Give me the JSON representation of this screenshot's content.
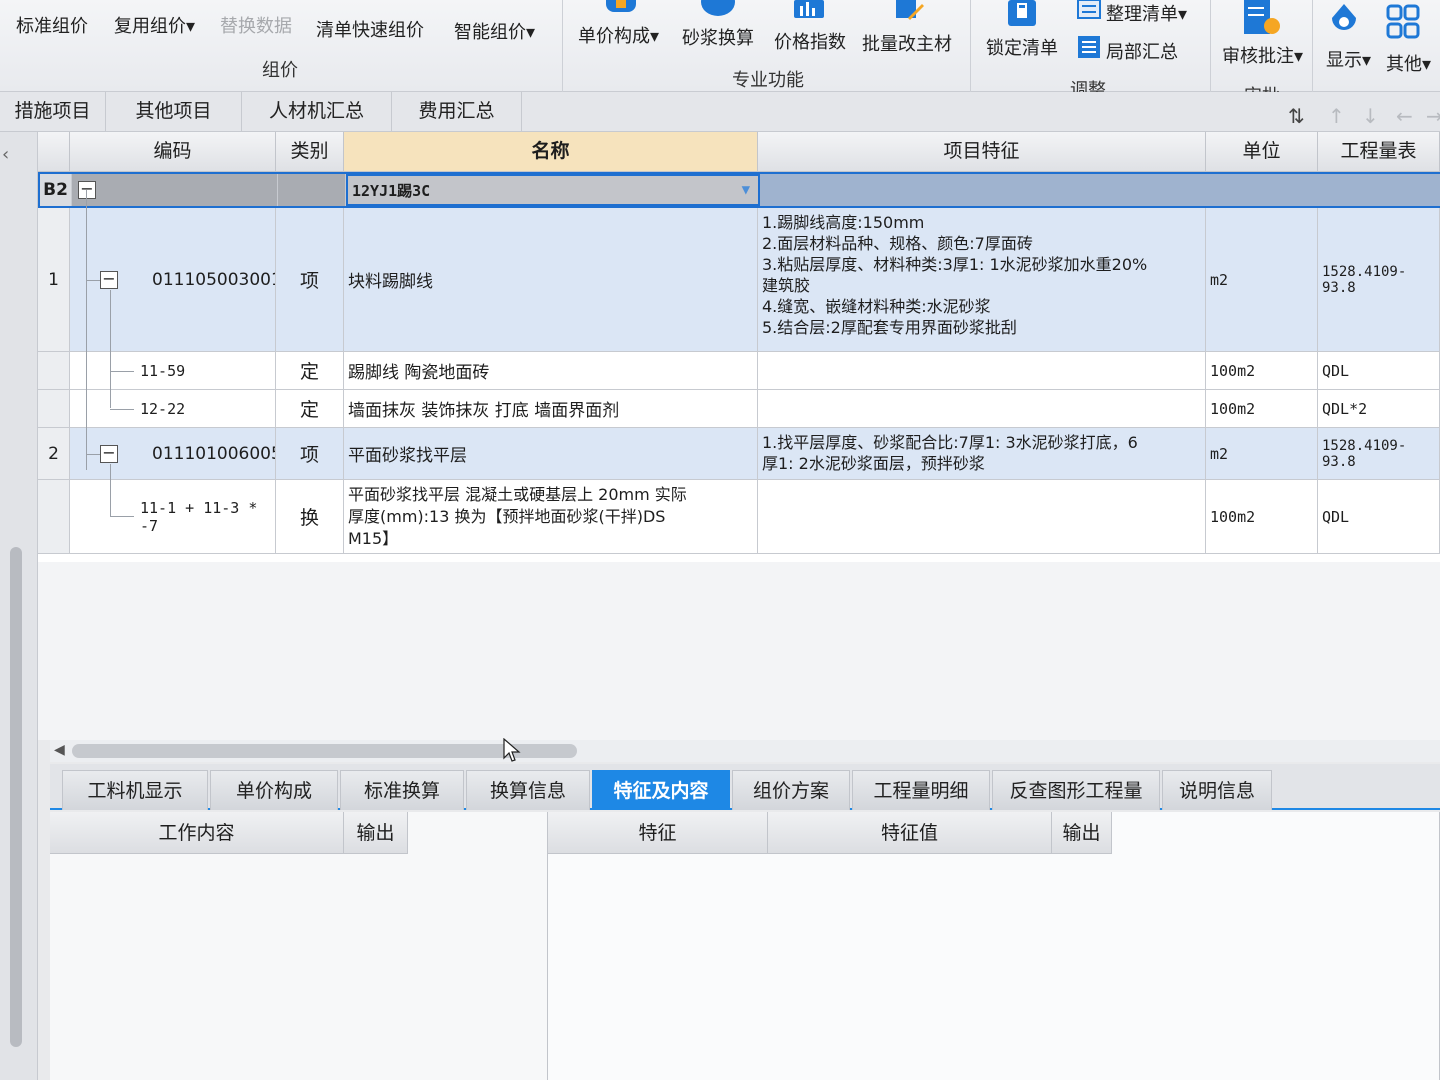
{
  "ribbon": {
    "items": [
      {
        "label": "标准组价"
      },
      {
        "label": "复用组价▾"
      },
      {
        "label": "替换数据",
        "disabled": true
      },
      {
        "label": "清单快速组价"
      },
      {
        "label": "智能组价▾"
      },
      {
        "label": "单价构成▾"
      },
      {
        "label": "砂浆换算"
      },
      {
        "label": "价格指数"
      },
      {
        "label": "批量改主材"
      },
      {
        "label": "锁定清单"
      },
      {
        "label": "整理清单▾"
      },
      {
        "label": "局部汇总"
      },
      {
        "label": "审核批注▾"
      },
      {
        "label": "显示▾"
      },
      {
        "label": "其他▾"
      }
    ],
    "groups": [
      "组价",
      "专业功能",
      "调整",
      "审批"
    ]
  },
  "top_tabs": [
    "措施项目",
    "其他项目",
    "人材机汇总",
    "费用汇总"
  ],
  "grid": {
    "headers": [
      "编码",
      "类别",
      "名称",
      "项目特征",
      "单位",
      "工程量表"
    ],
    "group_row": {
      "num": "B2",
      "name": "12YJ1踢3C"
    },
    "rows": [
      {
        "num": "1",
        "code": "011105003001",
        "type": "项",
        "name": "块料踢脚线",
        "features": [
          "1.踢脚线高度:150mm",
          "2.面层材料品种、规格、颜色:7厚面砖",
          "3.粘贴层厚度、材料种类:3厚1: 1水泥砂浆加水重20%",
          "建筑胶",
          "4.缝宽、嵌缝材料种类:水泥砂浆",
          "5.结合层:2厚配套专用界面砂浆批刮"
        ],
        "unit": "m2",
        "qty": "1528.4109-93.8"
      },
      {
        "num": "",
        "code": "11-59",
        "type": "定",
        "name": "踢脚线 陶瓷地面砖",
        "features": [],
        "unit": "100m2",
        "qty": "QDL"
      },
      {
        "num": "",
        "code": "12-22",
        "type": "定",
        "name": "墙面抹灰 装饰抹灰 打底 墙面界面剂",
        "features": [],
        "unit": "100m2",
        "qty": "QDL*2"
      },
      {
        "num": "2",
        "code": "011101006005",
        "type": "项",
        "name": "平面砂浆找平层",
        "features": [
          "1.找平层厚度、砂浆配合比:7厚1: 3水泥砂浆打底，6",
          "厚1: 2水泥砂浆面层，预拌砂浆"
        ],
        "unit": "m2",
        "qty": "1528.4109-93.8"
      },
      {
        "num": "",
        "code_lines": [
          "11-1 + 11-3 *",
          "-7"
        ],
        "type": "换",
        "name_lines": [
          "平面砂浆找平层 混凝土或硬基层上 20mm  实际",
          "厚度(mm):13  换为【预拌地面砂浆(干拌)DS",
          "M15】"
        ],
        "features": [],
        "unit": "100m2",
        "qty": "QDL"
      }
    ]
  },
  "bottom_tabs": [
    "工料机显示",
    "单价构成",
    "标准换算",
    "换算信息",
    "特征及内容",
    "组价方案",
    "工程量明细",
    "反查图形工程量",
    "说明信息"
  ],
  "active_bottom_tab": "特征及内容",
  "panels": {
    "left_headers": [
      "工作内容",
      "输出"
    ],
    "right_headers": [
      "特征",
      "特征值",
      "输出"
    ]
  },
  "colors": {
    "accent": "#1e88e5",
    "selected_header": "#f6e3bd",
    "item_row": "#dbe6f5"
  }
}
